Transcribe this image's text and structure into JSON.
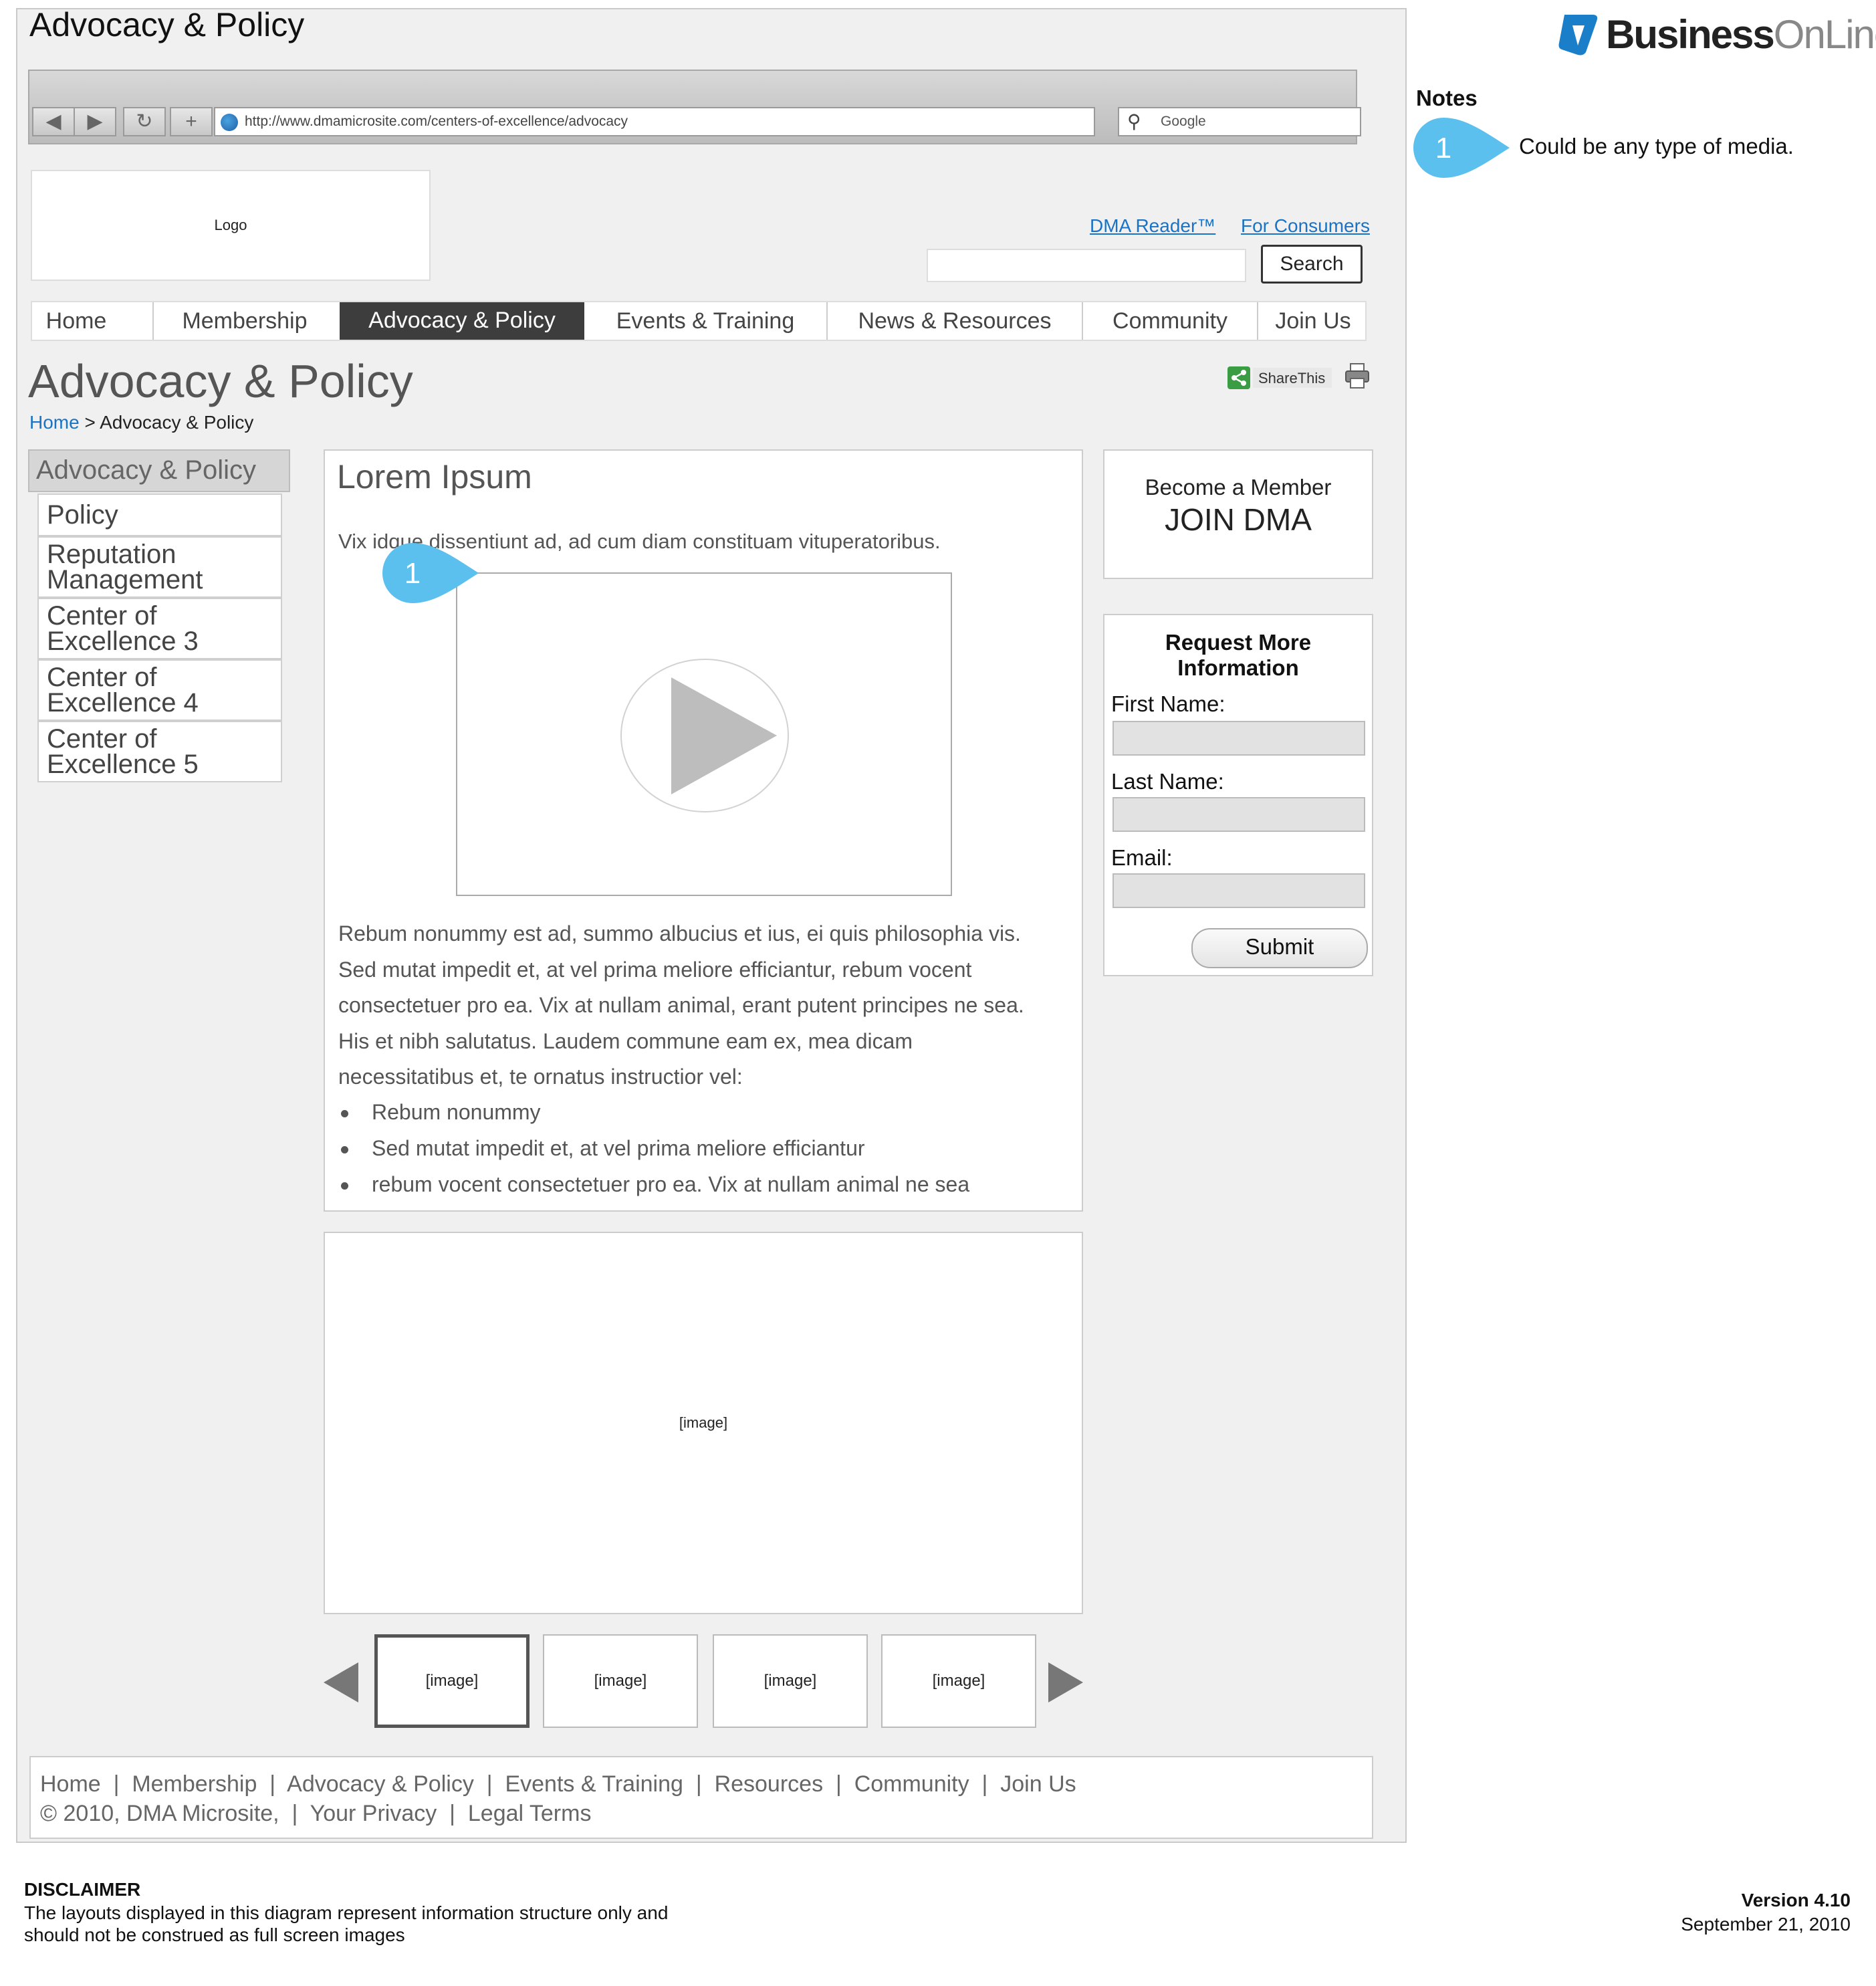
{
  "wireframe": {
    "title": "Advocacy & Policy"
  },
  "browser": {
    "url": "http://www.dmamicrosite.com/centers-of-excellence/advocacy",
    "search_placeholder": "Google"
  },
  "header": {
    "logo": "Logo",
    "links": [
      "DMA Reader™",
      "For Consumers"
    ],
    "search_button": "Search"
  },
  "nav": {
    "items": [
      "Home",
      "Membership",
      "Advocacy & Policy",
      "Events & Training",
      "News & Resources",
      "Community",
      "Join Us"
    ],
    "active": "Advocacy & Policy"
  },
  "page": {
    "title": "Advocacy & Policy",
    "breadcrumb": {
      "home": "Home",
      "sep": " > ",
      "current": "Advocacy & Policy"
    },
    "share_label": "ShareThis"
  },
  "sidebar": {
    "heading": "Advocacy & Policy",
    "items": [
      "Policy",
      "Reputation Management",
      "Center of Excellence 3",
      "Center of Excellence 4",
      "Center of Excellence 5"
    ]
  },
  "content": {
    "heading": "Lorem Ipsum",
    "intro": "Vix idque dissentiunt ad, ad cum diam constituam vituperatoribus.",
    "body_lines": [
      "Rebum nonummy est ad, summo albucius et ius, ei quis philosophia vis.",
      "Sed mutat impedit et, at vel prima meliore efficiantur, rebum vocent",
      "consectetuer pro ea. Vix at nullam animal, erant putent principes ne sea.",
      "His et nibh salutatus. Laudem commune eam ex, mea dicam",
      "necessitatibus et, te ornatus instructior vel:"
    ],
    "bullets": [
      "Rebum nonummy",
      "Sed mutat impedit et, at vel prima meliore efficiantur",
      "rebum vocent consectetuer pro ea. Vix at nullam animal ne sea"
    ]
  },
  "gallery": {
    "main": "[image]",
    "thumbs": [
      "[image]",
      "[image]",
      "[image]",
      "[image]"
    ]
  },
  "member_box": {
    "line1": "Become a Member",
    "line2": "JOIN DMA"
  },
  "form": {
    "title": "Request More Information",
    "fields": [
      "First Name:",
      "Last Name:",
      "Email:"
    ],
    "submit": "Submit"
  },
  "footer": {
    "row1": [
      "Home",
      "Membership",
      "Advocacy & Policy",
      "Events & Training",
      "Resources",
      "Community",
      "Join Us"
    ],
    "row2": [
      "© 2010, DMA Microsite,",
      "Your Privacy",
      "Legal Terms"
    ]
  },
  "annotations": {
    "notes_title": "Notes",
    "badge": "1",
    "note_1": "Could be any type of media."
  },
  "brand": {
    "bold": "Business",
    "light": "OnLine"
  },
  "disclaimer": {
    "title": "DISCLAIMER",
    "line1": "The layouts displayed in this diagram represent information structure only and",
    "line2": "should not be construed as full screen images"
  },
  "version": {
    "label": "Version 4.10",
    "date": "September 21, 2010"
  },
  "colors": {
    "link": "#1a73c4",
    "nav_active": "#3d3d3d",
    "badge": "#5bc0ee",
    "brand": "#1a7fc8"
  }
}
